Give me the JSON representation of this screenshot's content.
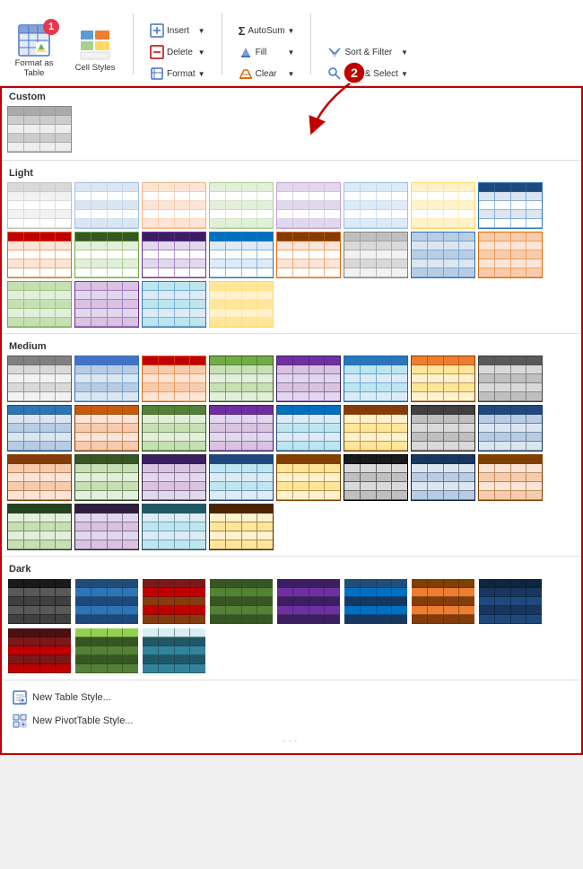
{
  "ribbon": {
    "format_as_table_label": "Format as\nTable",
    "cell_styles_label": "Cell\nStyles",
    "insert_label": "Insert",
    "delete_label": "Delete",
    "format_label": "Format",
    "autosum_label": "AutoSum",
    "fill_label": "Fill",
    "clear_label": "Clear",
    "sort_filter_label": "Sort &\nFilter",
    "find_select_label": "Find &\nSelect",
    "badge1": "1",
    "badge2": "2"
  },
  "sections": {
    "custom_label": "Custom",
    "light_label": "Light",
    "medium_label": "Medium",
    "dark_label": "Dark"
  },
  "bottom_buttons": {
    "new_table_style": "New Table Style...",
    "new_pivot_style": "New PivotTable Style..."
  },
  "light_styles": [
    {
      "header": "#ffffff",
      "row1": "#ffffff",
      "row2": "#f0f0f0",
      "border": "#aaaaaa",
      "type": "plain"
    },
    {
      "header": "#c5d9f1",
      "row1": "#dce6f1",
      "row2": "#ffffff",
      "border": "#95b3d7",
      "type": "blue"
    },
    {
      "header": "#e6b9b8",
      "row1": "#f2dbdb",
      "row2": "#ffffff",
      "border": "#d99694",
      "type": "red"
    },
    {
      "header": "#d7e4bc",
      "row1": "#ebf1de",
      "row2": "#ffffff",
      "border": "#9bbb59",
      "type": "green"
    },
    {
      "header": "#d0cee2",
      "row1": "#e4dfec",
      "row2": "#ffffff",
      "border": "#8064a2",
      "type": "purple"
    },
    {
      "header": "#c6efce",
      "row1": "#daeef3",
      "row2": "#ffffff",
      "border": "#4bacc6",
      "type": "teal"
    },
    {
      "header": "#fde9d9",
      "row1": "#fce4d6",
      "row2": "#ffffff",
      "border": "#e26b0a",
      "type": "orange"
    },
    {
      "header": "#1f497d",
      "row1": "#dce6f1",
      "row2": "#ffffff",
      "border": "#95b3d7",
      "type": "blue-dark"
    },
    {
      "header": "#953735",
      "row1": "#f2dbdb",
      "row2": "#ffffff",
      "border": "#d99694",
      "type": "red-dark"
    },
    {
      "header": "#76933c",
      "row1": "#ebf1de",
      "row2": "#ffffff",
      "border": "#9bbb59",
      "type": "green-dark"
    },
    {
      "header": "#403152",
      "row1": "#e4dfec",
      "row2": "#ffffff",
      "border": "#8064a2",
      "type": "purple-dark"
    },
    {
      "header": "#31849b",
      "row1": "#daeef3",
      "row2": "#ffffff",
      "border": "#4bacc6",
      "type": "teal-dark"
    },
    {
      "header": "#974706",
      "row1": "#fce4d6",
      "row2": "#ffffff",
      "border": "#e26b0a",
      "type": "orange-dark"
    },
    {
      "header": "#dce6f1",
      "row1": "#c5d9f1",
      "row2": "#dce6f1",
      "border": "#95b3d7",
      "type": "blue-stripe"
    },
    {
      "header": "#f2dbdb",
      "row1": "#e6b9b8",
      "row2": "#f2dbdb",
      "border": "#d99694",
      "type": "red-stripe"
    },
    {
      "header": "#ebf1de",
      "row1": "#d7e4bc",
      "row2": "#ebf1de",
      "border": "#9bbb59",
      "type": "green-stripe"
    },
    {
      "header": "#e4dfec",
      "row1": "#d0cee2",
      "row2": "#e4dfec",
      "border": "#8064a2",
      "type": "purple-stripe"
    },
    {
      "header": "#daeef3",
      "row1": "#c6efce",
      "row2": "#daeef3",
      "border": "#4bacc6",
      "type": "teal-stripe"
    },
    {
      "header": "#fce4d6",
      "row1": "#fde9d9",
      "row2": "#fce4d6",
      "border": "#e26b0a",
      "type": "orange-stripe"
    }
  ],
  "medium_styles": [
    {
      "header": "#4f81bd",
      "row1": "#dce6f1",
      "row2": "#b8cce4",
      "border": "#2f5496",
      "type": "blue-med"
    },
    {
      "header": "#c0504d",
      "row1": "#f2dcdb",
      "row2": "#e6b9b8",
      "border": "#943634",
      "type": "red-med"
    },
    {
      "header": "#9bbb59",
      "row1": "#ebf1de",
      "row2": "#d7e4bc",
      "border": "#76923c",
      "type": "green-med"
    },
    {
      "header": "#8064a2",
      "row1": "#e4dfec",
      "row2": "#d0cee2",
      "border": "#5f497a",
      "type": "purple-med"
    },
    {
      "header": "#4bacc6",
      "row1": "#daeef3",
      "row2": "#b7dee8",
      "border": "#31849b",
      "type": "teal-med"
    },
    {
      "header": "#f79646",
      "row1": "#fce4d6",
      "row2": "#fde9d9",
      "border": "#974706",
      "type": "orange-med"
    },
    {
      "header": "#1f497d",
      "row1": "#c5d9f1",
      "row2": "#dce6f1",
      "border": "#17375e",
      "type": "blue-med2"
    },
    {
      "header": "#953735",
      "row1": "#e6b9b8",
      "row2": "#f2dbdb",
      "border": "#632423",
      "type": "red-med2"
    },
    {
      "header": "#76933c",
      "row1": "#d7e4bc",
      "row2": "#ebf1de",
      "border": "#4f6228",
      "type": "green-med2"
    },
    {
      "header": "#403152",
      "row1": "#d0cee2",
      "row2": "#e4dfec",
      "border": "#3d3168",
      "type": "purple-med2"
    },
    {
      "header": "#31849b",
      "row1": "#b7dee8",
      "row2": "#daeef3",
      "border": "#215868",
      "type": "teal-med2"
    },
    {
      "header": "#974706",
      "row1": "#fde9d9",
      "row2": "#fce4d6",
      "border": "#6e3310",
      "type": "orange-med2"
    },
    {
      "header": "#17375e",
      "row1": "#dce6f1",
      "row2": "#b8cce4",
      "border": "#0f243e",
      "type": "blue-med3"
    },
    {
      "header": "#632423",
      "row1": "#f2dbdb",
      "row2": "#e6b9b8",
      "border": "#4f1c1c",
      "type": "red-med3"
    },
    {
      "header": "#4f6228",
      "row1": "#ebf1de",
      "row2": "#d7e4bc",
      "border": "#364420",
      "type": "green-med3"
    },
    {
      "header": "#3d3168",
      "row1": "#e4dfec",
      "row2": "#d0cee2",
      "border": "#2d224c",
      "type": "purple-med3"
    },
    {
      "header": "#215868",
      "row1": "#daeef3",
      "row2": "#b7dee8",
      "border": "#17393e",
      "type": "teal-med3"
    },
    {
      "header": "#6e3310",
      "row1": "#fce4d6",
      "row2": "#fde9d9",
      "border": "#4c240d",
      "type": "orange-med3"
    },
    {
      "header": "#808080",
      "row1": "#d9d9d9",
      "row2": "#f2f2f2",
      "border": "#595959",
      "type": "gray-med"
    },
    {
      "header": "#595959",
      "row1": "#d9d9d9",
      "row2": "#bfbfbf",
      "border": "#404040",
      "type": "gray-med2"
    },
    {
      "header": "#404040",
      "row1": "#bfbfbf",
      "row2": "#d9d9d9",
      "border": "#262626",
      "type": "gray-med3"
    },
    {
      "header": "#1a1a1a",
      "row1": "#d9d9d9",
      "row2": "#bfbfbf",
      "border": "#000000",
      "type": "gray-dark"
    },
    {
      "header": "#4f81bd",
      "row1": "#ffffff",
      "row2": "#dce6f1",
      "border": "#2f5496",
      "type": "blue-alt"
    },
    {
      "header": "#c0504d",
      "row1": "#ffffff",
      "row2": "#f2dcdb",
      "border": "#943634",
      "type": "red-alt"
    },
    {
      "header": "#9bbb59",
      "row1": "#ffffff",
      "row2": "#ebf1de",
      "border": "#76923c",
      "type": "green-alt"
    },
    {
      "header": "#8064a2",
      "row1": "#ffffff",
      "row2": "#e4dfec",
      "border": "#5f497a",
      "type": "purple-alt"
    },
    {
      "header": "#4bacc6",
      "row1": "#ffffff",
      "row2": "#daeef3",
      "border": "#31849b",
      "type": "teal-alt"
    },
    {
      "header": "#f79646",
      "row1": "#ffffff",
      "row2": "#fce4d6",
      "border": "#974706",
      "type": "orange-alt"
    }
  ],
  "dark_styles": [
    {
      "header": "#1f497d",
      "body": "#17375e",
      "accent": "#0f243e",
      "border": "#2f5496",
      "type": "blue-dark-full"
    },
    {
      "header": "#4f81bd",
      "body": "#1f497d",
      "accent": "#17375e",
      "border": "#4f81bd",
      "type": "blue-dark2"
    },
    {
      "header": "#953735",
      "body": "#632423",
      "accent": "#4f1c1c",
      "border": "#953735",
      "type": "red-dark-full"
    },
    {
      "header": "#4e8b4e",
      "body": "#375237",
      "accent": "#264226",
      "border": "#4e8b4e",
      "type": "green-dark-full"
    },
    {
      "header": "#403152",
      "body": "#2d1f3d",
      "accent": "#20163b",
      "border": "#403152",
      "type": "purple-dark-full"
    },
    {
      "header": "#31849b",
      "body": "#215868",
      "accent": "#17393e",
      "border": "#31849b",
      "type": "teal-dark-full"
    },
    {
      "header": "#e26b0a",
      "body": "#974706",
      "accent": "#6e3310",
      "border": "#e26b0a",
      "type": "orange-dark-full"
    },
    {
      "header": "#17375e",
      "body": "#0f243e",
      "accent": "#17375e",
      "border": "#17375e",
      "type": "blue-darkest"
    },
    {
      "header": "#632423",
      "body": "#4f1c1c",
      "accent": "#632423",
      "border": "#632423",
      "type": "red-darkest"
    },
    {
      "header": "#c6efce",
      "body": "#4e8b4e",
      "accent": "#375237",
      "border": "#4e8b4e",
      "type": "green-dark3"
    },
    {
      "header": "#daeef3",
      "body": "#31849b",
      "accent": "#215868",
      "border": "#31849b",
      "type": "teal-dark3"
    }
  ],
  "custom_style": {
    "header": "#aaaaaa",
    "row1": "#cccccc",
    "row2": "#eeeeee",
    "border": "#888888"
  }
}
